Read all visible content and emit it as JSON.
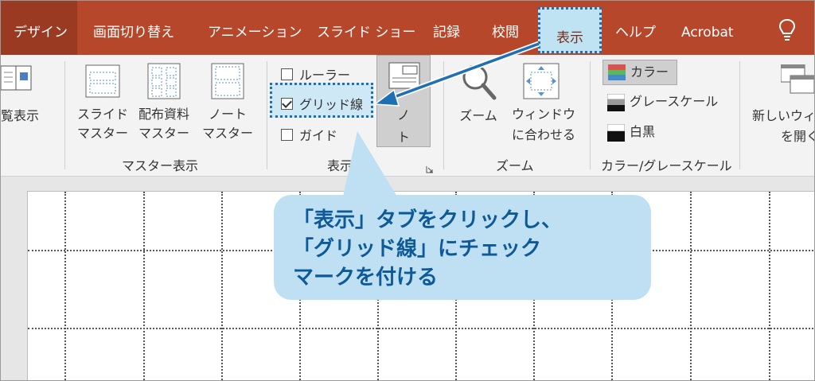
{
  "tabs": {
    "design": "デザイン",
    "transitions": "画面切り替え",
    "animations": "アニメーション",
    "slideshow": "スライド ショー",
    "record": "記録",
    "review": "校閲",
    "view": "表示",
    "help": "ヘルプ",
    "acrobat": "Acrobat"
  },
  "ribbon": {
    "reading_view": "覧表示",
    "slide_master_1": "スライド",
    "slide_master_2": "マスター",
    "handout_master_1": "配布資料",
    "handout_master_2": "マスター",
    "notes_master_1": "ノート",
    "notes_master_2": "マスター",
    "master_views_group": "マスター表示",
    "ruler": "ルーラー",
    "gridlines": "グリッド線",
    "guides": "ガイド",
    "show_group": "表示",
    "notes_1": "ノ",
    "notes_2": "ト",
    "zoom": "ズーム",
    "fit_window_1": "ウィンドウ",
    "fit_window_2": "に合わせる",
    "zoom_group": "ズーム",
    "color": "カラー",
    "grayscale": "グレースケール",
    "black_white": "白黒",
    "color_group": "カラー/グレースケール",
    "new_window_1": "新しいウィ",
    "new_window_2": "を開く"
  },
  "callout": {
    "line1": "「表示」タブをクリックし、",
    "line2": "「グリッド線」にチェック",
    "line3": "マークを付ける"
  },
  "colors": {
    "tab_bar": "#b7472a",
    "view_tab_bg": "#bfe3f2",
    "highlight_border": "#1f6fb4",
    "callout_bg": "#bfe0f3",
    "callout_text": "#0e5a99"
  }
}
